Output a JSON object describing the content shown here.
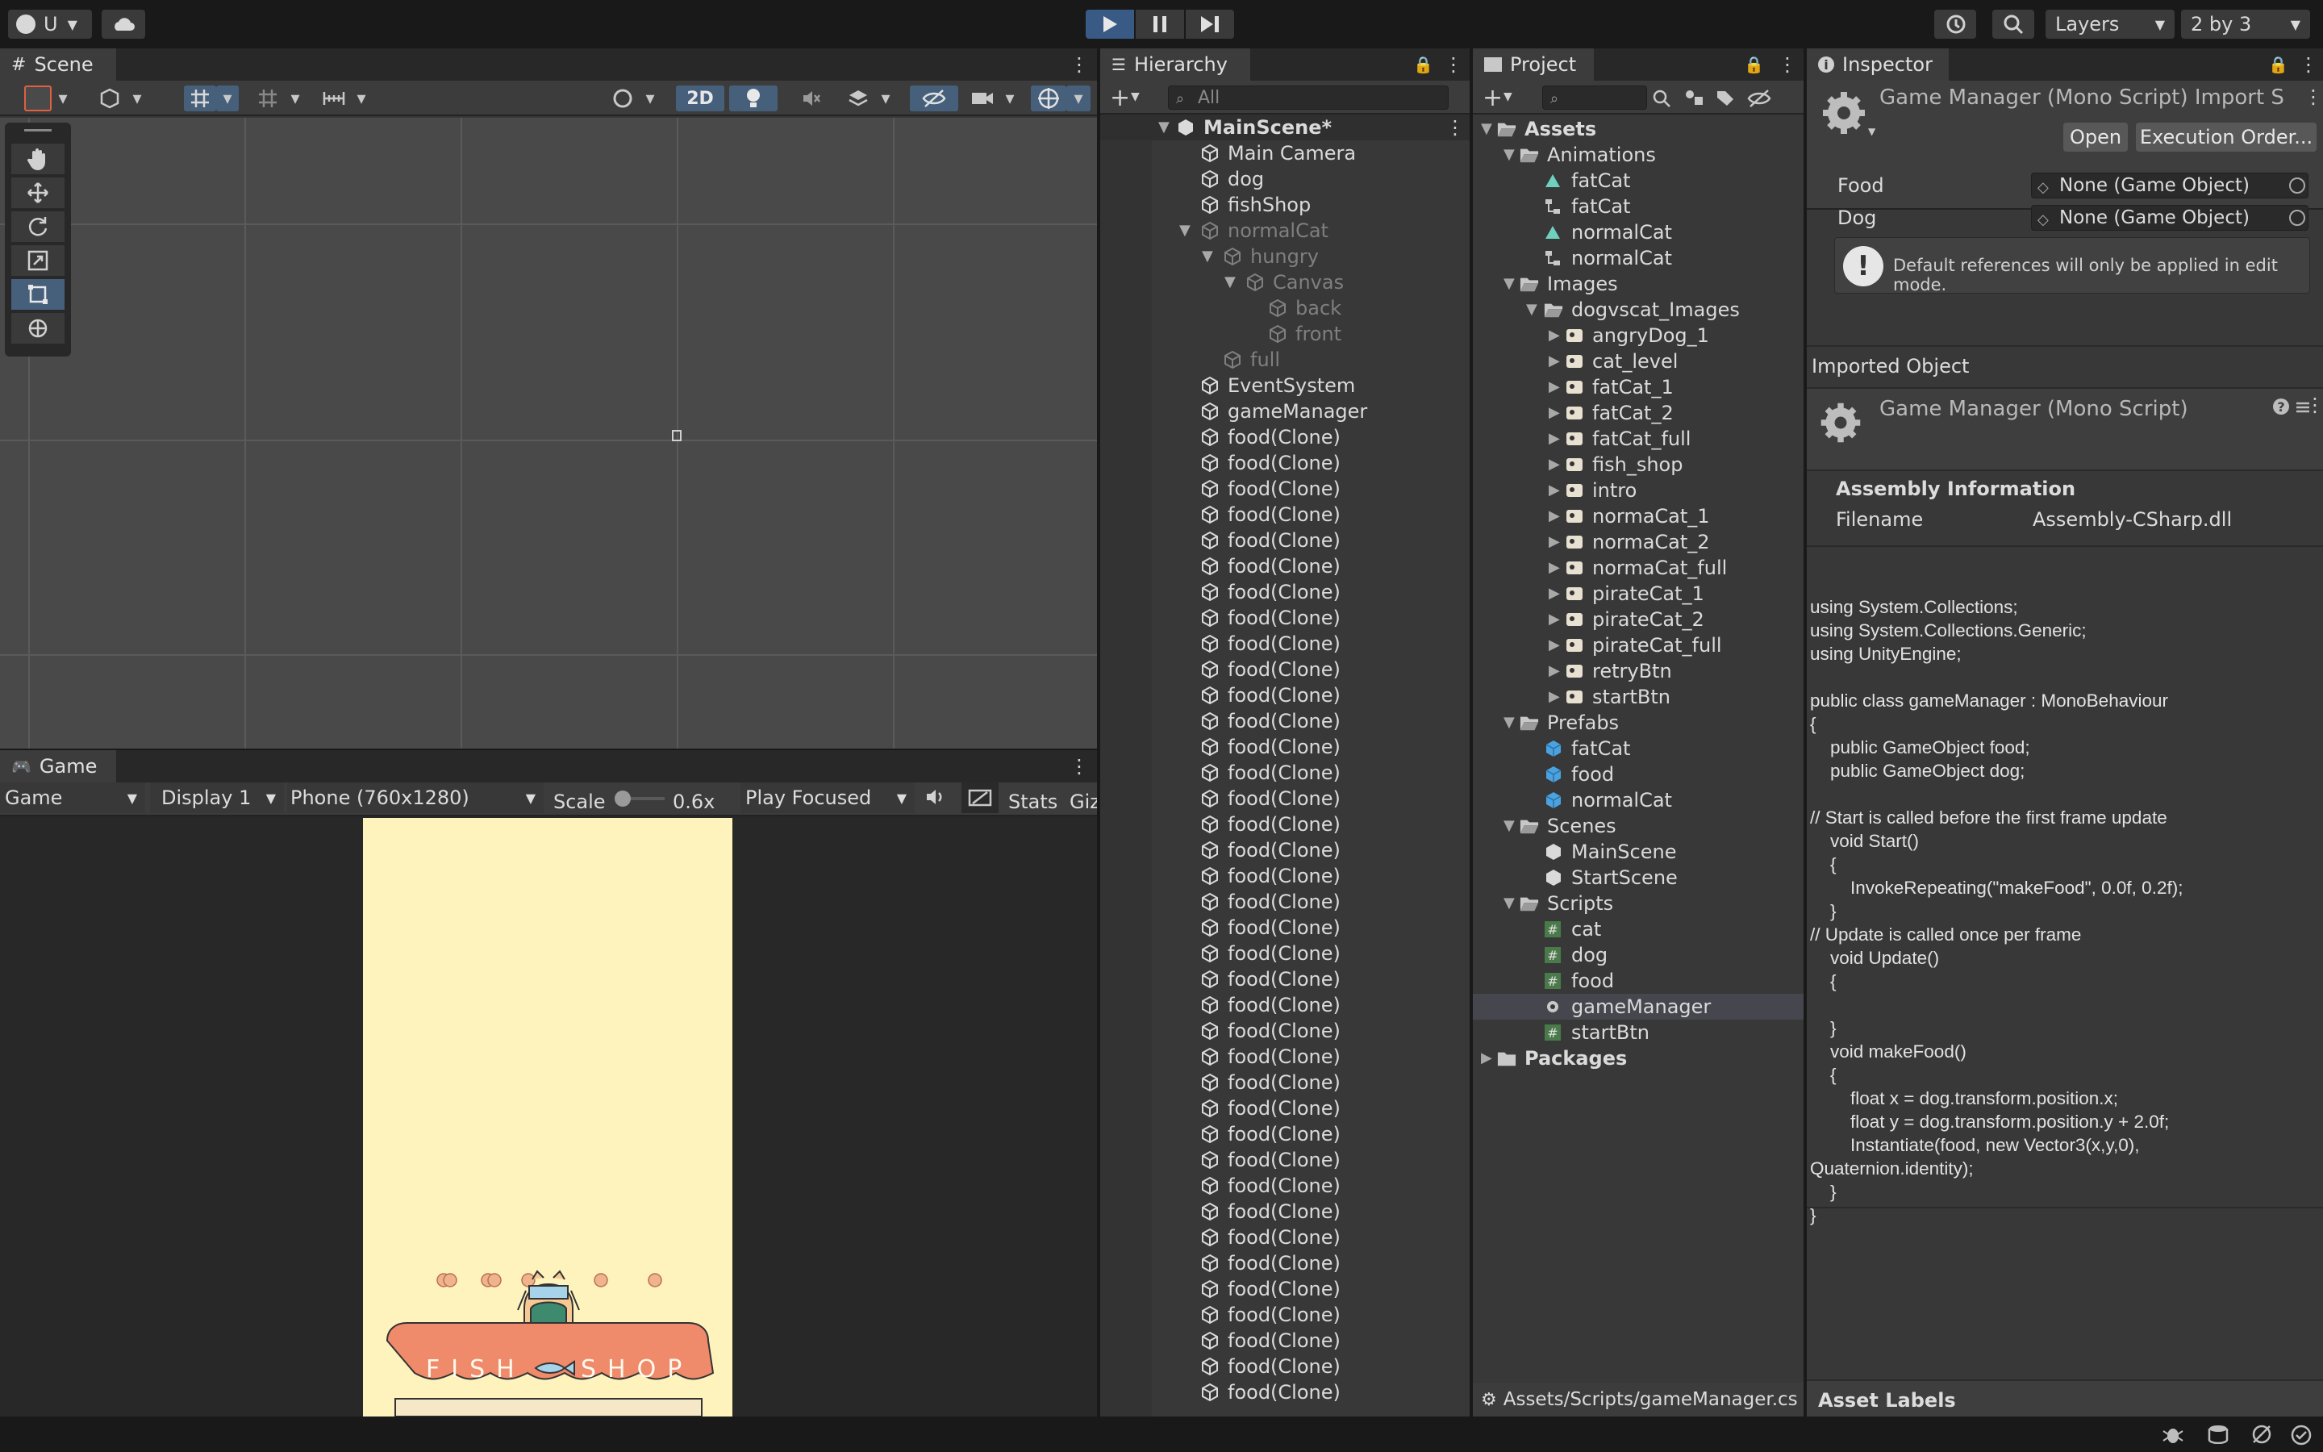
{
  "topbar": {
    "account_label": "U",
    "layers_label": "Layers",
    "layout_label": "2 by 3"
  },
  "scene": {
    "tab_label": "Scene",
    "toggle_2d": "2D"
  },
  "game": {
    "tab_label": "Game",
    "mode": "Game",
    "display": "Display 1",
    "resolution": "Phone (760x1280)",
    "scale_label": "Scale",
    "scale_value": "0.6x",
    "play_focus": "Play Focused",
    "stats": "Stats",
    "gizmos": "Giz",
    "banner_left": "FISH",
    "banner_right": "SHOP"
  },
  "hierarchy": {
    "tab_label": "Hierarchy",
    "search_placeholder": "All",
    "scene_name": "MainScene*",
    "items": [
      {
        "label": "Main Camera"
      },
      {
        "label": "dog"
      },
      {
        "label": "fishShop"
      },
      {
        "label": "normalCat"
      },
      {
        "label": "hungry"
      },
      {
        "label": "Canvas"
      },
      {
        "label": "back"
      },
      {
        "label": "front"
      },
      {
        "label": "full"
      },
      {
        "label": "EventSystem"
      },
      {
        "label": "gameManager"
      }
    ],
    "clones": [
      "food(Clone)",
      "food(Clone)",
      "food(Clone)",
      "food(Clone)",
      "food(Clone)",
      "food(Clone)",
      "food(Clone)",
      "food(Clone)",
      "food(Clone)",
      "food(Clone)",
      "food(Clone)",
      "food(Clone)",
      "food(Clone)",
      "food(Clone)",
      "food(Clone)",
      "food(Clone)",
      "food(Clone)",
      "food(Clone)",
      "food(Clone)",
      "food(Clone)",
      "food(Clone)",
      "food(Clone)",
      "food(Clone)",
      "food(Clone)",
      "food(Clone)",
      "food(Clone)",
      "food(Clone)",
      "food(Clone)",
      "food(Clone)",
      "food(Clone)",
      "food(Clone)",
      "food(Clone)",
      "food(Clone)",
      "food(Clone)",
      "food(Clone)",
      "food(Clone)",
      "food(Clone)",
      "food(Clone)"
    ]
  },
  "project": {
    "tab_label": "Project",
    "path": "Assets/Scripts/gameManager.cs",
    "items": [
      {
        "label": "Assets"
      },
      {
        "label": "Animations"
      },
      {
        "label": "fatCat"
      },
      {
        "label": "fatCat"
      },
      {
        "label": "normalCat"
      },
      {
        "label": "normalCat"
      },
      {
        "label": "Images"
      },
      {
        "label": "dogvscat_Images"
      },
      {
        "label": "angryDog_1"
      },
      {
        "label": "cat_level"
      },
      {
        "label": "fatCat_1"
      },
      {
        "label": "fatCat_2"
      },
      {
        "label": "fatCat_full"
      },
      {
        "label": "fish_shop"
      },
      {
        "label": "intro"
      },
      {
        "label": "normaCat_1"
      },
      {
        "label": "normaCat_2"
      },
      {
        "label": "normaCat_full"
      },
      {
        "label": "pirateCat_1"
      },
      {
        "label": "pirateCat_2"
      },
      {
        "label": "pirateCat_full"
      },
      {
        "label": "retryBtn"
      },
      {
        "label": "startBtn"
      },
      {
        "label": "Prefabs"
      },
      {
        "label": "fatCat"
      },
      {
        "label": "food"
      },
      {
        "label": "normalCat"
      },
      {
        "label": "Scenes"
      },
      {
        "label": "MainScene"
      },
      {
        "label": "StartScene"
      },
      {
        "label": "Scripts"
      },
      {
        "label": "cat"
      },
      {
        "label": "dog"
      },
      {
        "label": "food"
      },
      {
        "label": "gameManager"
      },
      {
        "label": "startBtn"
      },
      {
        "label": "Packages"
      }
    ]
  },
  "inspector": {
    "tab_label": "Inspector",
    "title": "Game Manager (Mono Script) Import S",
    "open_button": "Open",
    "execution_button": "Execution Order...",
    "food_label": "Food",
    "food_value": "None (Game Object)",
    "dog_label": "Dog",
    "dog_value": "None (Game Object)",
    "info_message": "Default references will only be applied in edit mode.",
    "imported_object": "Imported Object",
    "script_title": "Game Manager (Mono Script)",
    "assembly_heading": "Assembly Information",
    "filename_label": "Filename",
    "filename_value": "Assembly-CSharp.dll",
    "code": "using System.Collections;\nusing System.Collections.Generic;\nusing UnityEngine;\n\npublic class gameManager : MonoBehaviour\n{\n    public GameObject food;\n    public GameObject dog;\n\n// Start is called before the first frame update\n    void Start()\n    {\n        InvokeRepeating(\"makeFood\", 0.0f, 0.2f);\n    }\n// Update is called once per frame\n    void Update()\n    {\n\n    }\n    void makeFood()\n    {\n        float x = dog.transform.position.x;\n        float y = dog.transform.position.y + 2.0f;\n        Instantiate(food, new Vector3(x,y,0),\nQuaternion.identity);\n    }\n}",
    "asset_labels": "Asset Labels"
  },
  "colors": {
    "accent": "#46607c",
    "play_active": "#3a5a86",
    "game_bg": "#fff3bd",
    "banner": "#ef8a6a"
  }
}
